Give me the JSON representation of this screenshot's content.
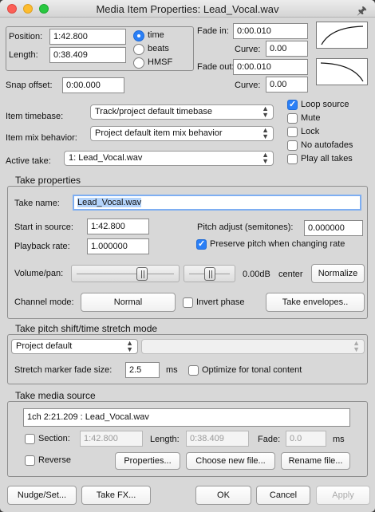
{
  "window": {
    "title": "Media Item Properties:  Lead_Vocal.wav"
  },
  "position": {
    "position_label": "Position:",
    "position_value": "1:42.800",
    "length_label": "Length:",
    "length_value": "0:38.409",
    "snap_label": "Snap offset:",
    "snap_value": "0:00.000"
  },
  "time_format": {
    "options": [
      "time",
      "beats",
      "HMSF"
    ],
    "selected": "time"
  },
  "fades": {
    "fade_in_label": "Fade in:",
    "fade_in_value": "0:00.010",
    "curve_label": "Curve:",
    "curve_in_value": "0.00",
    "fade_out_label": "Fade out:",
    "fade_out_value": "0:00.010",
    "curve_out_value": "0.00"
  },
  "item": {
    "timebase_label": "Item timebase:",
    "timebase_value": "Track/project default timebase",
    "mix_label": "Item mix behavior:",
    "mix_value": "Project default item mix behavior",
    "active_take_label": "Active take:",
    "active_take_value": "1: Lead_Vocal.wav"
  },
  "item_flags": [
    {
      "label": "Loop source",
      "checked": true
    },
    {
      "label": "Mute",
      "checked": false
    },
    {
      "label": "Lock",
      "checked": false
    },
    {
      "label": "No autofades",
      "checked": false
    },
    {
      "label": "Play all takes",
      "checked": false
    }
  ],
  "take": {
    "section_title": "Take properties",
    "name_label": "Take name:",
    "name_value": "Lead_Vocal.wav",
    "start_label": "Start in source:",
    "start_value": "1:42.800",
    "pitch_label": "Pitch adjust (semitones):",
    "pitch_value": "0.000000",
    "rate_label": "Playback rate:",
    "rate_value": "1.000000",
    "preserve_label": "Preserve pitch when changing rate",
    "preserve_checked": true,
    "volpan_label": "Volume/pan:",
    "volume_readout": "0.00dB",
    "pan_readout": "center",
    "normalize_label": "Normalize",
    "volume_level": 0.5,
    "pan_level": 0.5,
    "channel_label": "Channel mode:",
    "channel_value": "Normal",
    "invert_label": "Invert phase",
    "invert_checked": false,
    "envelopes_label": "Take envelopes.."
  },
  "pitch_shift": {
    "section_title": "Take pitch shift/time stretch mode",
    "mode_value": "Project default",
    "submode_value": "",
    "fade_label": "Stretch marker fade size:",
    "fade_value": "2.5",
    "fade_unit": "ms",
    "optimize_label": "Optimize for tonal content",
    "optimize_checked": false
  },
  "media": {
    "section_title": "Take media source",
    "source_value": "1ch 2:21.209 : Lead_Vocal.wav",
    "section_label": "Section:",
    "section_value": "1:42.800",
    "length_label": "Length:",
    "length_value": "0:38.409",
    "fade_label": "Fade:",
    "fade_value": "0.0",
    "fade_unit": "ms",
    "reverse_label": "Reverse",
    "properties_label": "Properties...",
    "choose_label": "Choose new file...",
    "rename_label": "Rename file..."
  },
  "footer": {
    "nudge": "Nudge/Set...",
    "takefx": "Take FX...",
    "ok": "OK",
    "cancel": "Cancel",
    "apply": "Apply"
  },
  "icons": {
    "pin": "pin-icon",
    "fade_in": "fade-in-curve-icon",
    "fade_out": "fade-out-curve-icon"
  },
  "colors": {
    "accent": "#2a7ff6",
    "window_bg": "#d8d8d8"
  }
}
